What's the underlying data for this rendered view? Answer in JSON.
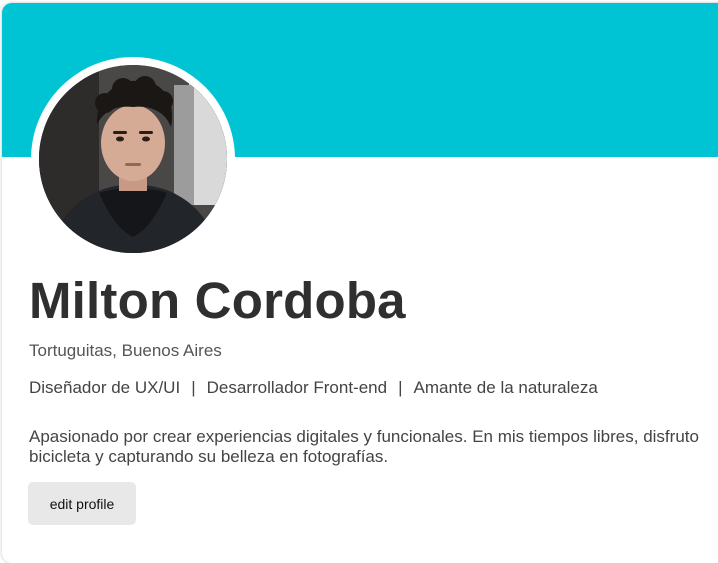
{
  "profile": {
    "name": "Milton Cordoba",
    "location": "Tortuguitas, Buenos Aires",
    "roles": [
      "Diseñador de UX/UI",
      "Desarrollador Front-end",
      "Amante de la naturaleza"
    ],
    "role_separator": "|",
    "bio_line1": "Apasionado por crear experiencias digitales y funcionales. En mis tiempos libres, disfruto",
    "bio_line2": "bicicleta y capturando su belleza en fotografías.",
    "edit_button_label": "edit profile",
    "avatar_icon": "profile-photo"
  },
  "colors": {
    "banner": "#00c4d4",
    "button_bg": "#e8e8e8",
    "name_text": "#2f2f2f"
  }
}
